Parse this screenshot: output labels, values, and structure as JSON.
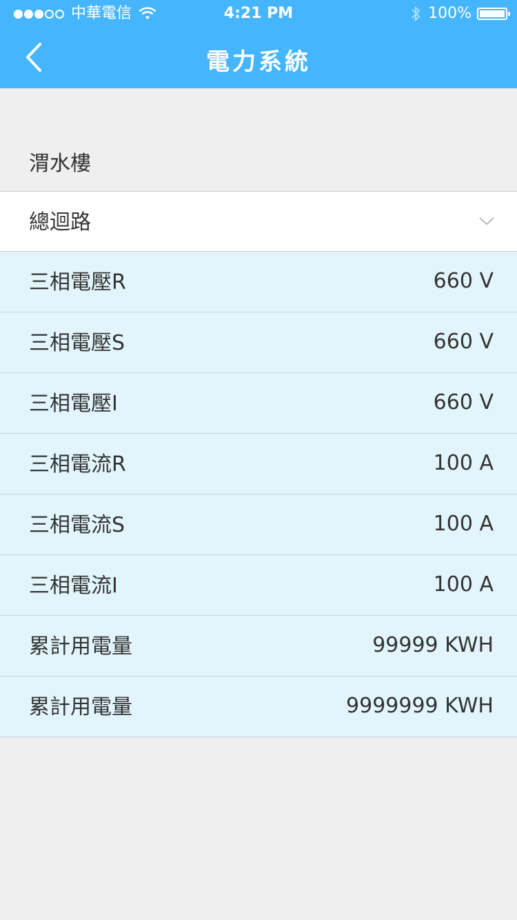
{
  "status_bar": {
    "carrier": "中華電信",
    "time": "4:21 PM",
    "battery_percent": "100%",
    "battery_level": 1.0,
    "signal_bars": 3,
    "signal_total": 5,
    "icons": [
      "wifi-icon",
      "bluetooth-icon",
      "battery-icon"
    ]
  },
  "nav": {
    "title": "電力系統",
    "back_icon": "chevron-left-icon"
  },
  "section": {
    "title": "渭水樓"
  },
  "dropdown": {
    "selected": "總迴路",
    "icon": "chevron-down-icon"
  },
  "rows": [
    {
      "label": "三相電壓R",
      "value": "660 V"
    },
    {
      "label": "三相電壓S",
      "value": "660 V"
    },
    {
      "label": "三相電壓I",
      "value": "660 V"
    },
    {
      "label": "三相電流R",
      "value": "100 A"
    },
    {
      "label": "三相電流S",
      "value": "100 A"
    },
    {
      "label": "三相電流I",
      "value": "100 A"
    },
    {
      "label": "累計用電量",
      "value": "99999 KWH"
    },
    {
      "label": "累計用電量",
      "value": "9999999 KWH"
    }
  ],
  "colors": {
    "header_bg": "#45b6fd",
    "page_bg": "#efefef",
    "row_bg": "#e2f5fc",
    "text": "#333333"
  }
}
